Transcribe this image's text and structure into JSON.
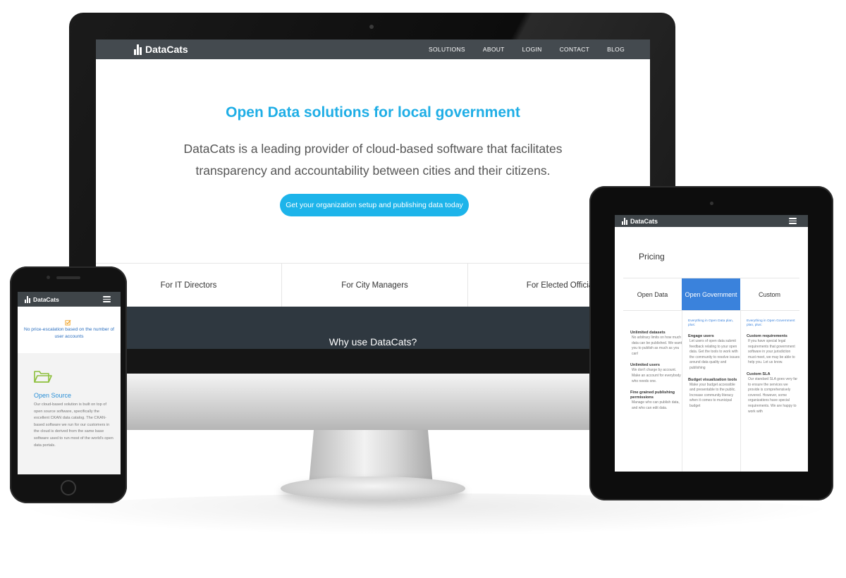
{
  "desktop": {
    "brand": "DataCats",
    "nav": [
      "SOLUTIONS",
      "ABOUT",
      "LOGIN",
      "CONTACT",
      "BLOG"
    ],
    "hero_title": "Open Data solutions for local government",
    "hero_text": "DataCats is a leading provider of cloud-based software that facilitates transparency and accountability between cities and their citizens.",
    "cta": "Get your organization setup and publishing data today",
    "audience_tabs": [
      "For IT Directors",
      "For City Managers",
      "For Elected Officia"
    ],
    "why_heading": "Why use DataCats?"
  },
  "tablet": {
    "brand": "DataCats",
    "pricing_title": "Pricing",
    "plans": [
      "Open Data",
      "Open Government",
      "Custom"
    ],
    "active_plan": "Open Government",
    "columns": [
      {
        "intro": "",
        "features": [
          {
            "title": "Unlimited datasets",
            "text": "No arbitrary limits on how much data can be published. We want you to publish as much as you can!"
          },
          {
            "title": "Unlimited users",
            "text": "We don't charge by account. Make an account for everybody who needs one."
          },
          {
            "title": "Fine grained publishing permissions",
            "text": "Manage who can publish data, and who can edit data."
          }
        ]
      },
      {
        "intro": "Everything in Open Data plan, plus:",
        "features": [
          {
            "title": "Engage users",
            "text": "Let users of open data submit feedback relating to your open data. Get the tools to work with the community to resolve issues around data quality and publishing"
          },
          {
            "title": "Budget visualization tools",
            "text": "Make your budget accessible and presentable to the public. Increase community literacy when it comes to municipal budget"
          }
        ]
      },
      {
        "intro": "Everything in Open Government plan, plus:",
        "features": [
          {
            "title": "Custom requirements",
            "text": "If you have special legal requirements that government software in your jurisdiction must meet, we may be able to help you. Let us know."
          },
          {
            "title": "Custom SLA",
            "text": "Our standard SLA goes very far to ensure the services we provide is comprehensively covered. However, some organizations have special requirements. We are happy to work with"
          }
        ]
      }
    ]
  },
  "phone": {
    "brand": "DataCats",
    "message": "No price-escalation based on the number of user accounts",
    "feature_title": "Open Source",
    "feature_text": "Our cloud-based solution is built on top of open source software, specifically the excellent CKAN data catalog. The CKAN-based software we run for our customers in the cloud is derived from the same base software used to run most of the world's open data portals."
  },
  "colors": {
    "accent": "#1faee6",
    "button": "#1db4ea",
    "nav_bg": "#444a4f",
    "band_dark": "#2f3840",
    "plan_active": "#3a82dc",
    "phone_link": "#2a8fd6",
    "check_orange": "#f0a020",
    "folder_green": "#8dbf3c"
  }
}
